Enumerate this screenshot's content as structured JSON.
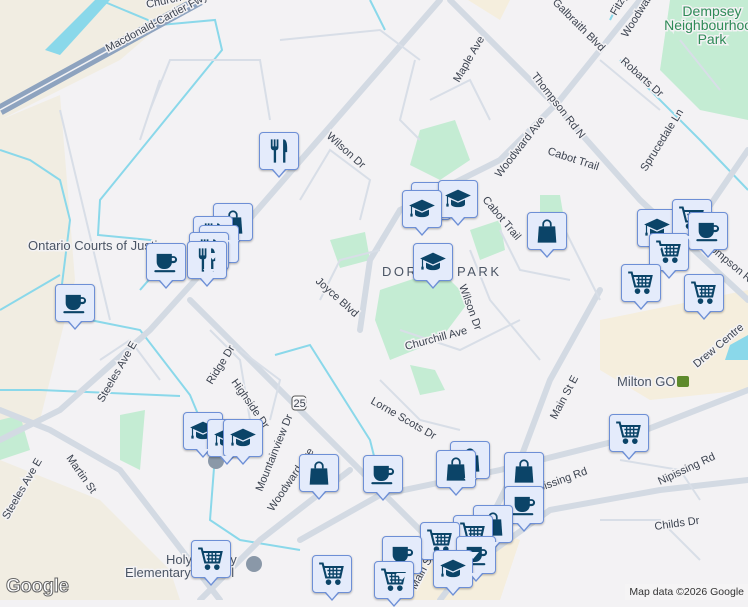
{
  "map": {
    "streets": {
      "church": "Church St",
      "macdonald": "Macdonald-Cartier Fwy",
      "wilson_n": "Wilson Dr",
      "wilson_s": "Wilson Dr",
      "maple": "Maple Ave",
      "galbraith": "Galbraith Blvd",
      "fitzgerald": "Fitzg",
      "woodward_n": "Woodward Ave",
      "woodward_mid": "Woodward Ave",
      "woodward_sw": "Woodward Ave",
      "thompson": "Thompson Rd N",
      "thompson_s": "Thompson Rd",
      "robarts": "Robarts Dr",
      "sprucedale": "Sprucedale Ln",
      "cabot1": "Cabot Trail",
      "cabot2": "Cabot Trail",
      "joyce": "Joyce Blvd",
      "churchill": "Churchill Ave",
      "lorne": "Lorne Scots Dr",
      "main": "Main St E",
      "main_s": "Main St E",
      "drew": "Drew Centre",
      "nipissing1": "Nipissing Rd",
      "nipissing2": "Nipissing Rd",
      "childs": "Childs Dr",
      "steeles1": "Steeles Ave E",
      "steeles2": "Steeles Ave E",
      "martin": "Martin St",
      "ridge": "Ridge Dr",
      "highside": "Highside Dr",
      "mountainview": "Mountainview Dr",
      "route": "25"
    },
    "places": {
      "courts": "Ontario Courts of Justice",
      "dorset": "DORSET PARK",
      "dempsey": [
        "Dempsey",
        "Neighbourhood",
        "Park"
      ],
      "milton_go": "Milton GO",
      "holy": [
        "Holy Rosary",
        "Elementary School"
      ]
    },
    "markers": [
      {
        "type": "restaurant"
      },
      {
        "type": "shopping"
      },
      {
        "type": "restaurant"
      },
      {
        "type": "restaurant"
      },
      {
        "type": "restaurant"
      },
      {
        "type": "restaurant"
      },
      {
        "type": "coffee"
      },
      {
        "type": "coffee"
      },
      {
        "type": "school"
      },
      {
        "type": "school"
      },
      {
        "type": "school"
      },
      {
        "type": "school"
      },
      {
        "type": "shopping"
      },
      {
        "type": "school"
      },
      {
        "type": "cart"
      },
      {
        "type": "coffee"
      },
      {
        "type": "cart"
      },
      {
        "type": "cart"
      },
      {
        "type": "cart"
      },
      {
        "type": "school"
      },
      {
        "type": "school"
      },
      {
        "type": "school"
      },
      {
        "type": "shopping"
      },
      {
        "type": "coffee"
      },
      {
        "type": "shopping"
      },
      {
        "type": "shopping"
      },
      {
        "type": "shopping"
      },
      {
        "type": "coffee"
      },
      {
        "type": "shopping"
      },
      {
        "type": "cart"
      },
      {
        "type": "cart"
      },
      {
        "type": "coffee"
      },
      {
        "type": "coffee"
      },
      {
        "type": "school"
      },
      {
        "type": "cart"
      },
      {
        "type": "cart"
      },
      {
        "type": "cart"
      },
      {
        "type": "cart"
      }
    ],
    "logo": "Google",
    "attribution": "Map data ©2026 Google",
    "colors": {
      "marker_icon": "#0b4468",
      "marker_bg": "#e4ebfb",
      "park": "#c4ecd3",
      "water": "#8ad8ea",
      "road": "#d3dae3"
    }
  }
}
